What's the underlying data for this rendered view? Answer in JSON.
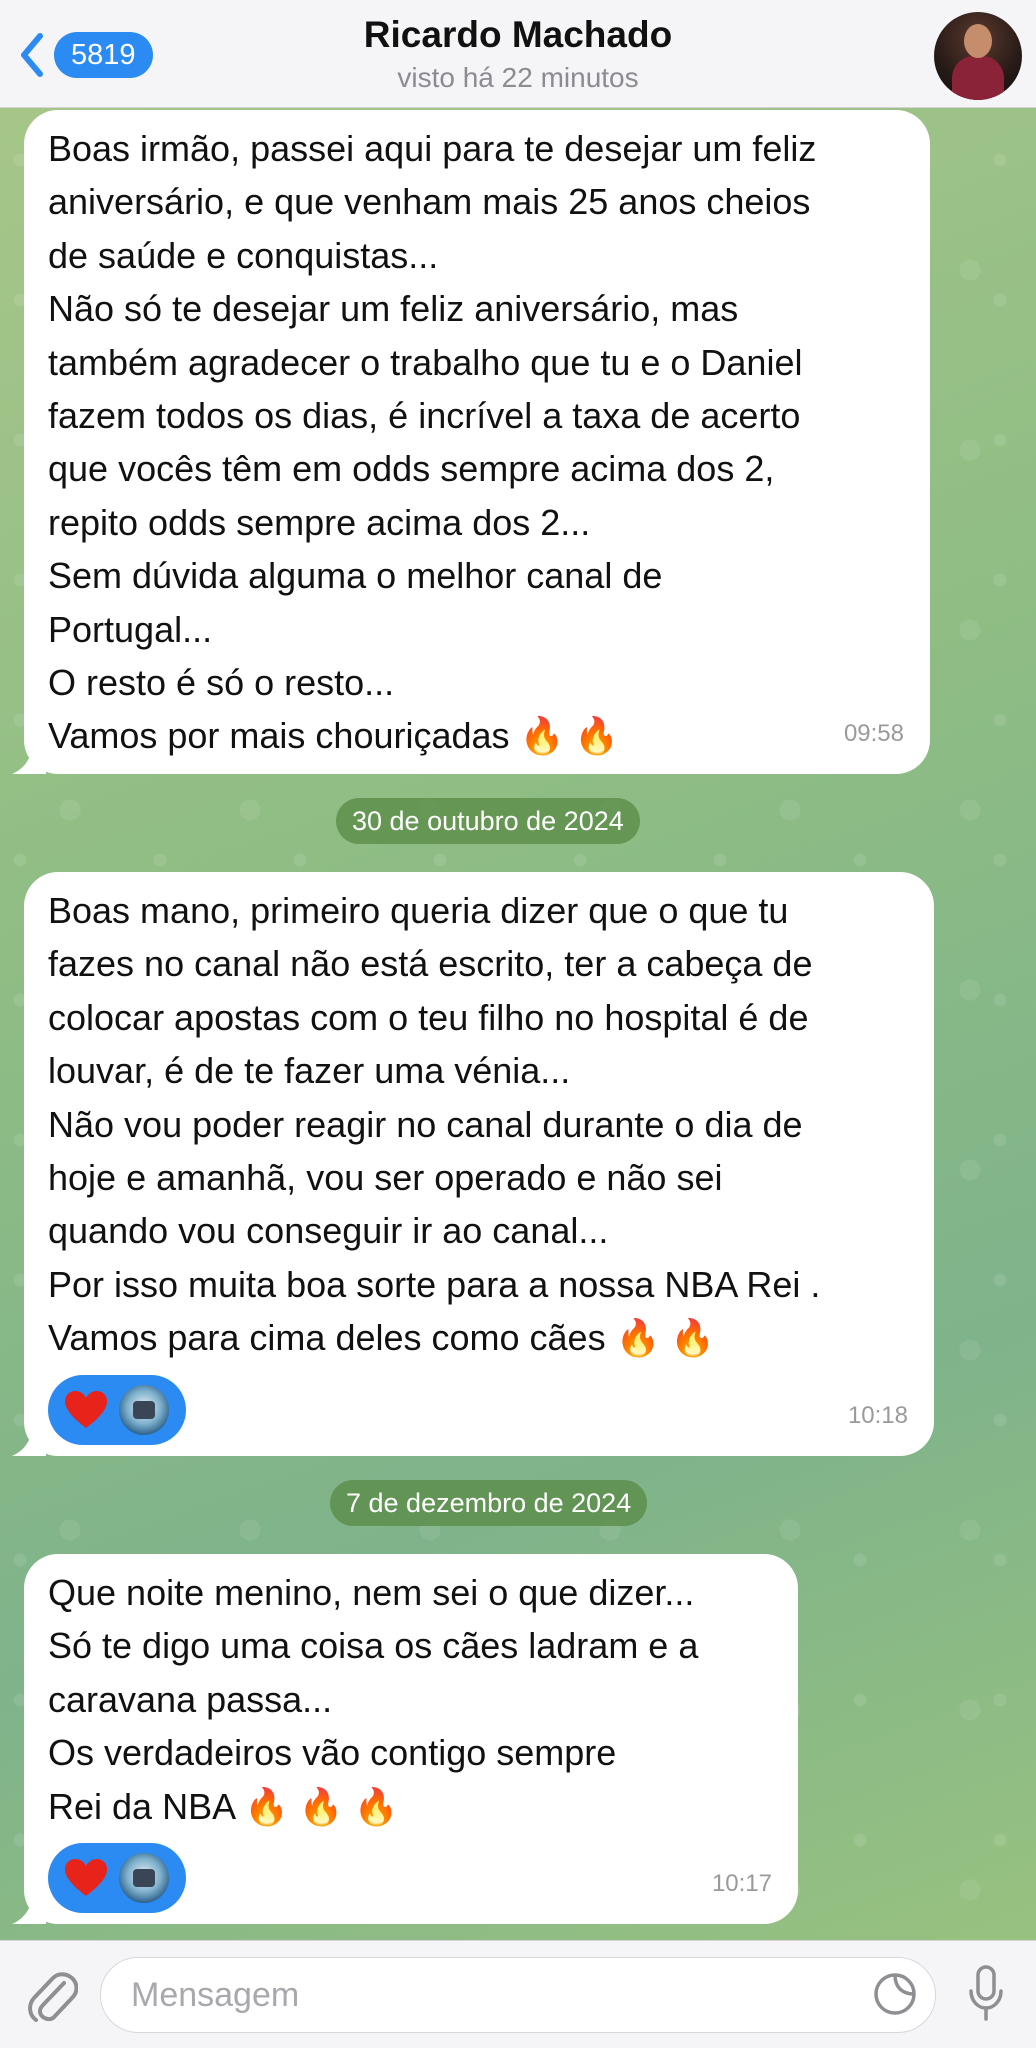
{
  "header": {
    "badge_count": "5819",
    "contact_name": "Ricardo Machado",
    "last_seen": "visto há 22 minutos"
  },
  "messages": [
    {
      "text": "Boas irmão, passei aqui para te desejar um feliz\naniversário, e que venham mais 25 anos cheios\nde saúde e conquistas...\nNão só te desejar um feliz aniversário, mas\ntambém agradecer o trabalho que tu e o Daniel\nfazem todos os dias, é incrível a taxa de acerto\nque vocês têm em odds sempre acima dos 2,\nrepito odds sempre acima dos 2...\nSem dúvida alguma o melhor canal de\nPortugal...\nO resto é só o resto...\nVamos por mais chouriçadas 🔥 🔥",
      "time": "09:58"
    },
    {
      "date_separator": "30 de outubro de 2024",
      "text": "Boas mano, primeiro queria dizer que o que tu\nfazes no canal não está escrito, ter a cabeça de\ncolocar apostas com o teu filho no hospital é de\nlouvar, é de te fazer uma vénia...\nNão vou poder reagir no canal durante o dia de\nhoje e amanhã, vou ser operado e não sei\nquando vou conseguir ir ao canal...\nPor isso muita boa sorte para a nossa NBA Rei .\nVamos para cima deles como cães 🔥 🔥",
      "time": "10:18",
      "reaction": "heart"
    },
    {
      "date_separator": "7 de dezembro de 2024",
      "text": "Que noite menino, nem sei o que dizer...\nSó te digo uma coisa os cães ladram e a\ncaravana passa...\nOs verdadeiros vão contigo sempre\nRei da NBA 🔥 🔥 🔥",
      "time": "10:17",
      "reaction": "heart"
    }
  ],
  "composer": {
    "placeholder": "Mensagem"
  },
  "colors": {
    "accent": "#2b8bf2",
    "date_pill": "#588a44",
    "bubble": "#ffffff"
  }
}
